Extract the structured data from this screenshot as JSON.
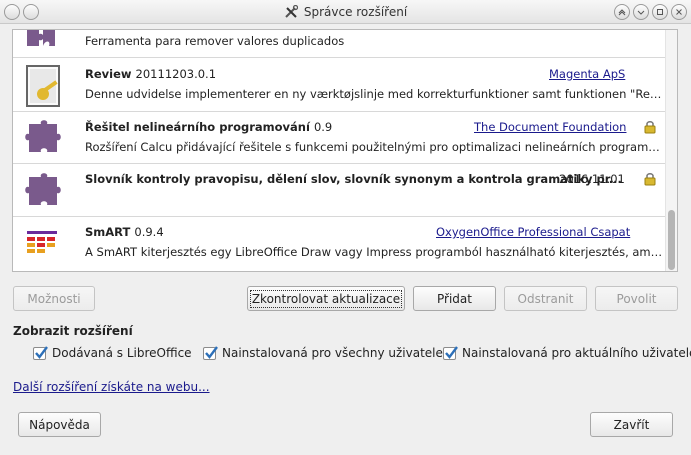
{
  "window": {
    "title": "Správce rozšíření"
  },
  "extensions": [
    {
      "name": "",
      "version": "",
      "publisher": "",
      "description": "Ferramenta para remover valores duplicados",
      "icon": "puzzle-icon",
      "locked": false
    },
    {
      "name": "Review",
      "version": "20111203.0.1",
      "publisher": "Magenta ApS",
      "description": "Denne udvidelse implementerer en ny værktøjslinje med korrekturfunktioner samt funktionen \"Rens do...",
      "icon": "document-key-icon",
      "locked": false
    },
    {
      "name": "Řešitel nelineárního programování",
      "version": "0.9",
      "publisher": "The Document Foundation",
      "description": "Rozšíření Calcu přidávající řešitele s funkcemi použitelnými pro optimalizaci nelineárních programovač...",
      "icon": "puzzle-icon",
      "locked": true
    },
    {
      "name": "Slovník kontroly pravopisu, dělení slov, slovník synonym a kontrola gramatiky pr...",
      "version": "2016.11.01",
      "publisher": "",
      "description": "",
      "icon": "puzzle-icon",
      "locked": true
    },
    {
      "name": "SmART",
      "version": "0.9.4",
      "publisher": "OxygenOffice Professional Csapat",
      "description": "A SmART kiterjesztés egy LibreOffice Draw vagy Impress programból használható kiterjesztés, amellyel n...",
      "icon": "smart-icon",
      "locked": false
    }
  ],
  "buttons": {
    "options": "Možnosti",
    "check_updates": "Zkontrolovat aktualizace",
    "add": "Přidat",
    "remove": "Odstranit",
    "enable": "Povolit",
    "help": "Nápověda",
    "close": "Zavřít"
  },
  "filter": {
    "title": "Zobrazit rozšíření",
    "bundled": "Dodávaná s LibreOffice",
    "shared": "Nainstalovaná pro všechny uživatele",
    "user": "Nainstalovaná pro aktuálního uživatele"
  },
  "get_more_link": "Další rozšíření získáte na webu...",
  "colors": {
    "puzzle": "#7a5a8c",
    "link": "#1a1a8c",
    "lock": "#d8b830",
    "checkbox_tick": "#2c6fb8"
  }
}
